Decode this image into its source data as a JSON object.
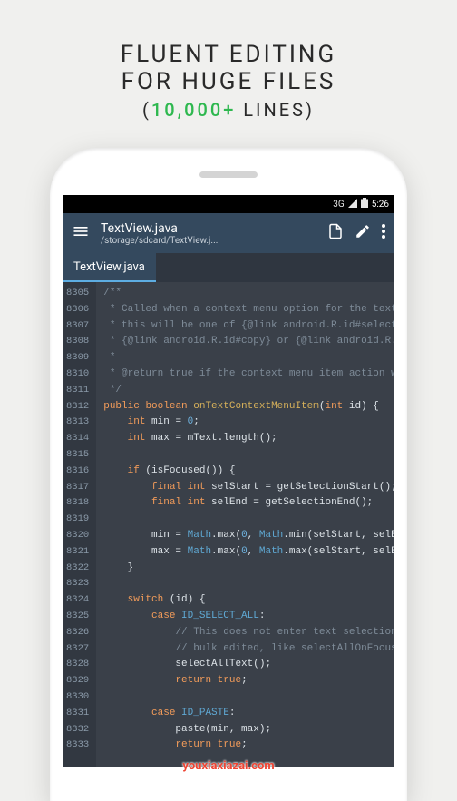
{
  "promo": {
    "line1": "FLUENT EDITING",
    "line2": "FOR HUGE FILES",
    "line3_prefix": "(",
    "line3_accent": "10,000+",
    "line3_suffix": " LINES)"
  },
  "statusbar": {
    "network": "3G",
    "time": "5:26"
  },
  "appbar": {
    "title": "TextView.java",
    "subtitle": "/storage/sdcard/TextView.j..."
  },
  "tab": {
    "label": "TextView.java"
  },
  "gutter_start": 8305,
  "gutter_end": 8333,
  "code_lines": [
    [
      [
        "comment",
        "/**"
      ]
    ],
    [
      [
        "comment",
        " * Called when a context menu option for the text"
      ]
    ],
    [
      [
        "comment",
        " * this will be one of {@link android.R.id#selectAll"
      ]
    ],
    [
      [
        "comment",
        " * {@link android.R.id#copy} or {@link android.R.id"
      ]
    ],
    [
      [
        "comment",
        " *"
      ]
    ],
    [
      [
        "comment",
        " * @return true if the context menu item action wa"
      ]
    ],
    [
      [
        "comment",
        " */"
      ]
    ],
    [
      [
        "keyword",
        "public "
      ],
      [
        "keyword",
        "boolean "
      ],
      [
        "method",
        "onTextContextMenuItem"
      ],
      [
        "plain",
        "("
      ],
      [
        "keyword",
        "int"
      ],
      [
        "plain",
        " id) {"
      ]
    ],
    [
      [
        "plain",
        "    "
      ],
      [
        "keyword",
        "int"
      ],
      [
        "plain",
        " min = "
      ],
      [
        "number",
        "0"
      ],
      [
        "plain",
        ";"
      ]
    ],
    [
      [
        "plain",
        "    "
      ],
      [
        "keyword",
        "int"
      ],
      [
        "plain",
        " max = mText.length();"
      ]
    ],
    [
      [
        "plain",
        ""
      ]
    ],
    [
      [
        "plain",
        "    "
      ],
      [
        "keyword",
        "if"
      ],
      [
        "plain",
        " (isFocused()) {"
      ]
    ],
    [
      [
        "plain",
        "        "
      ],
      [
        "keyword",
        "final int"
      ],
      [
        "plain",
        " selStart = getSelectionStart();"
      ]
    ],
    [
      [
        "plain",
        "        "
      ],
      [
        "keyword",
        "final int"
      ],
      [
        "plain",
        " selEnd = getSelectionEnd();"
      ]
    ],
    [
      [
        "plain",
        ""
      ]
    ],
    [
      [
        "plain",
        "        min = "
      ],
      [
        "class",
        "Math"
      ],
      [
        "plain",
        ".max("
      ],
      [
        "number",
        "0"
      ],
      [
        "plain",
        ", "
      ],
      [
        "class",
        "Math"
      ],
      [
        "plain",
        ".min(selStart, selEnd"
      ]
    ],
    [
      [
        "plain",
        "        max = "
      ],
      [
        "class",
        "Math"
      ],
      [
        "plain",
        ".max("
      ],
      [
        "number",
        "0"
      ],
      [
        "plain",
        ", "
      ],
      [
        "class",
        "Math"
      ],
      [
        "plain",
        ".max(selStart, selEnd"
      ]
    ],
    [
      [
        "plain",
        "    }"
      ]
    ],
    [
      [
        "plain",
        ""
      ]
    ],
    [
      [
        "plain",
        "    "
      ],
      [
        "keyword",
        "switch"
      ],
      [
        "plain",
        " (id) {"
      ]
    ],
    [
      [
        "plain",
        "        "
      ],
      [
        "keyword",
        "case"
      ],
      [
        "plain",
        " "
      ],
      [
        "const",
        "ID_SELECT_ALL"
      ],
      [
        "plain",
        ":"
      ]
    ],
    [
      [
        "plain",
        "            "
      ],
      [
        "comment",
        "// This does not enter text selection mode."
      ]
    ],
    [
      [
        "plain",
        "            "
      ],
      [
        "comment",
        "// bulk edited, like selectAllOnFocus does."
      ]
    ],
    [
      [
        "plain",
        "            selectAllText();"
      ]
    ],
    [
      [
        "plain",
        "            "
      ],
      [
        "keyword",
        "return true"
      ],
      [
        "plain",
        ";"
      ]
    ],
    [
      [
        "plain",
        ""
      ]
    ],
    [
      [
        "plain",
        "        "
      ],
      [
        "keyword",
        "case"
      ],
      [
        "plain",
        " "
      ],
      [
        "const",
        "ID_PASTE"
      ],
      [
        "plain",
        ":"
      ]
    ],
    [
      [
        "plain",
        "            paste(min, max);"
      ]
    ],
    [
      [
        "plain",
        "            "
      ],
      [
        "keyword",
        "return true"
      ],
      [
        "plain",
        ";"
      ]
    ]
  ],
  "watermark": "youxiaxiazai.com"
}
